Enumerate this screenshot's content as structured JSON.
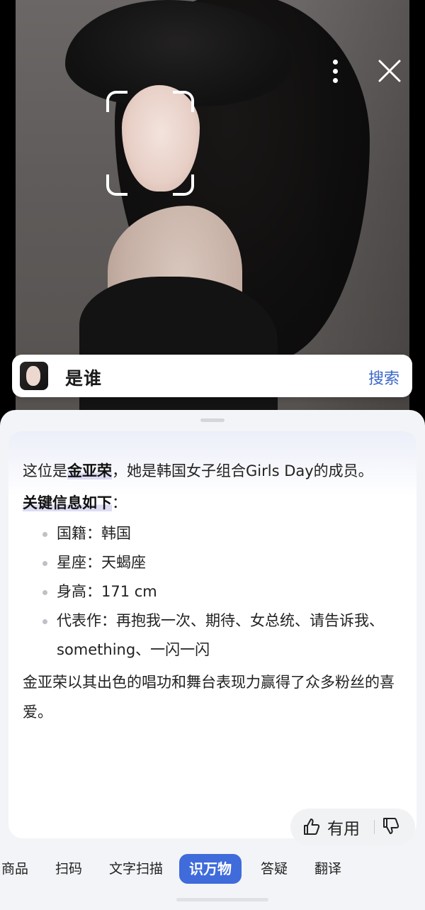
{
  "top_bar": {
    "more_icon": "more-vertical-icon",
    "close_icon": "close-icon"
  },
  "who_card": {
    "label": "是谁",
    "search_label": "搜索"
  },
  "answer": {
    "intro_prefix": "这位是",
    "name": "金亚荣",
    "intro_suffix": "，她是韩国女子组合Girls Day的成员。",
    "key_heading": "关键信息如下",
    "key_colon": "：",
    "facts": [
      "国籍：韩国",
      "星座：天蝎座",
      "身高：171 cm",
      "代表作：再抱我一次、期待、女总统、请告诉我、something、一闪一闪"
    ],
    "closing": "金亚荣以其出色的唱功和舞台表现力赢得了众多粉丝的喜爱。"
  },
  "feedback": {
    "useful_label": "有用",
    "thumbs_up_icon": "thumbs-up-icon",
    "thumbs_down_icon": "thumbs-down-icon"
  },
  "tabs": [
    {
      "label": "商品",
      "active": false
    },
    {
      "label": "扫码",
      "active": false
    },
    {
      "label": "文字扫描",
      "active": false
    },
    {
      "label": "识万物",
      "active": true
    },
    {
      "label": "答疑",
      "active": false
    },
    {
      "label": "翻译",
      "active": false
    }
  ]
}
